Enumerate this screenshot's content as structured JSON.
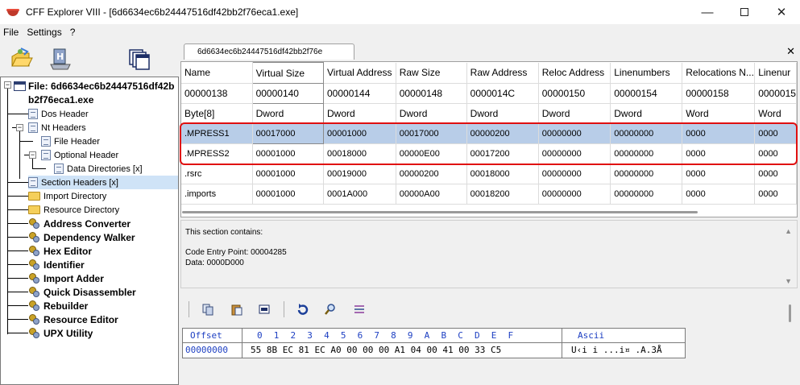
{
  "window": {
    "title": "CFF Explorer VIII - [6d6634ec6b24447516df42bb2f76eca1.exe]",
    "minimize": "—",
    "close": "✕"
  },
  "menu": [
    "File",
    "Settings",
    "?"
  ],
  "tab": {
    "label": "6d6634ec6b24447516df42bb2f76e",
    "close": "✕"
  },
  "tree": {
    "root_line1": "File: 6d6634ec6b24447516df42b",
    "root_line2": "b2f76eca1.exe",
    "items": [
      {
        "label": "Dos Header"
      },
      {
        "label": "Nt Headers"
      },
      {
        "label": "File Header"
      },
      {
        "label": "Optional Header"
      },
      {
        "label": "Data Directories [x]"
      },
      {
        "label": "Section Headers [x]"
      },
      {
        "label": "Import Directory"
      },
      {
        "label": "Resource Directory"
      },
      {
        "label": "Address Converter"
      },
      {
        "label": "Dependency Walker"
      },
      {
        "label": "Hex Editor"
      },
      {
        "label": "Identifier"
      },
      {
        "label": "Import Adder"
      },
      {
        "label": "Quick Disassembler"
      },
      {
        "label": "Rebuilder"
      },
      {
        "label": "Resource Editor"
      },
      {
        "label": "UPX Utility"
      }
    ]
  },
  "sections_table": {
    "columns": [
      "Name",
      "Virtual Size",
      "Virtual Address",
      "Raw Size",
      "Raw Address",
      "Reloc Address",
      "Linenumbers",
      "Relocations N...",
      "Linenur"
    ],
    "offsets": [
      "00000138",
      "00000140",
      "00000144",
      "00000148",
      "0000014C",
      "00000150",
      "00000154",
      "00000158",
      "0000015"
    ],
    "types": [
      "Byte[8]",
      "Dword",
      "Dword",
      "Dword",
      "Dword",
      "Dword",
      "Dword",
      "Word",
      "Word"
    ],
    "rows": [
      [
        ".MPRESS1",
        "00017000",
        "00001000",
        "00017000",
        "00000200",
        "00000000",
        "00000000",
        "0000",
        "0000"
      ],
      [
        ".MPRESS2",
        "00001000",
        "00018000",
        "00000E00",
        "00017200",
        "00000000",
        "00000000",
        "0000",
        "0000"
      ],
      [
        ".rsrc",
        "00001000",
        "00019000",
        "00000200",
        "00018000",
        "00000000",
        "00000000",
        "0000",
        "0000"
      ],
      [
        ".imports",
        "00001000",
        "0001A000",
        "00000A00",
        "00018200",
        "00000000",
        "00000000",
        "0000",
        "0000"
      ]
    ]
  },
  "info": {
    "line1": "This section contains:",
    "line2": "Code Entry Point: 00004285",
    "line3": "Data: 0000D000"
  },
  "hex_view": {
    "header_offset": "Offset",
    "header_cols": "0  1  2  3  4  5  6  7  8  9  A  B  C  D  E  F",
    "header_ascii": "Ascii",
    "offset": "00000000",
    "bytes": "55 8B EC 81 EC A0 00 00 00 A1 04 00 41 00 33 C5",
    "ascii": "U‹i i ...i¤ .A.3Å"
  }
}
